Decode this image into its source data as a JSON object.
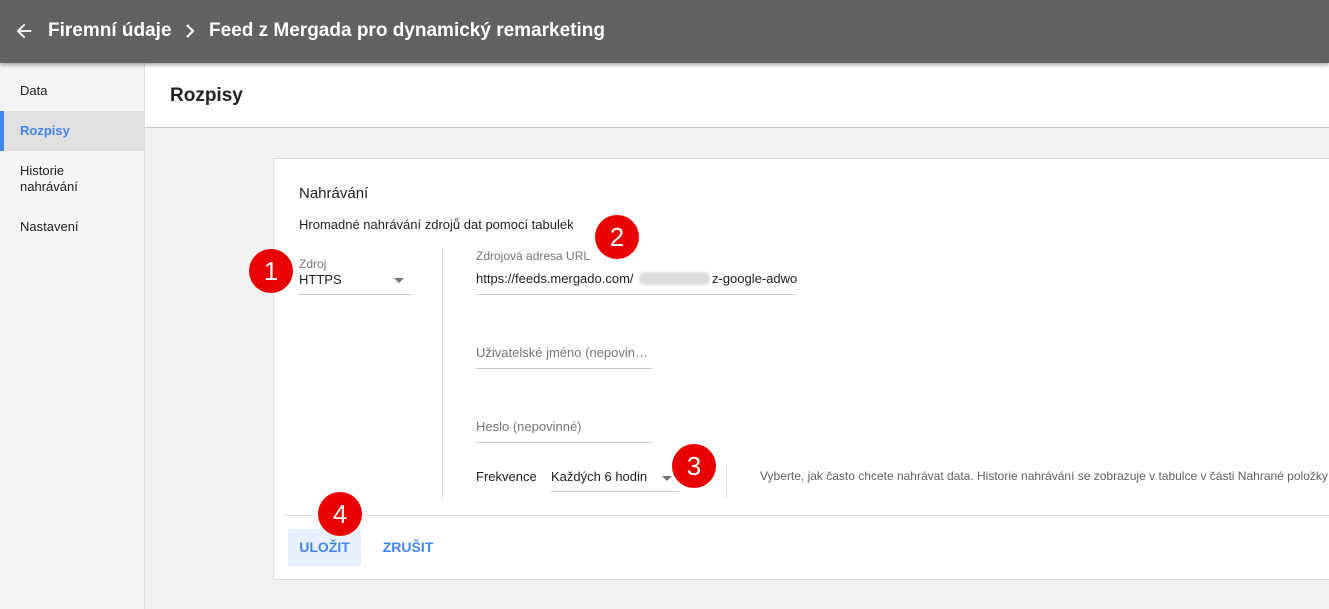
{
  "header": {
    "back_icon": "arrow-left-icon",
    "breadcrumb_parent": "Firemní údaje",
    "separator_icon": "chevron-right-icon",
    "breadcrumb_current": "Feed z Mergada pro dynamický remarketing"
  },
  "sidebar": {
    "items": [
      {
        "label": "Data",
        "active": false
      },
      {
        "label": "Rozpisy",
        "active": true
      },
      {
        "label": "Historie nahrávání",
        "active": false
      },
      {
        "label": "Nastavení",
        "active": false
      }
    ]
  },
  "page": {
    "title": "Rozpisy"
  },
  "upload": {
    "section_title": "Nahrávání",
    "subtitle": "Hromadné nahrávání zdrojů dat pomocí tabulek",
    "source": {
      "label": "Zdroj",
      "value": "HTTPS"
    },
    "url": {
      "label": "Zdrojová adresa URL",
      "value_prefix": "https://feeds.mergado.com/",
      "value_suffix": "z-google-adwo"
    },
    "username": {
      "placeholder": "Uživatelské jméno (nepovinné)"
    },
    "password": {
      "placeholder": "Heslo (nepovinné)"
    },
    "frequency": {
      "label": "Frekvence",
      "value": "Každých 6 hodin",
      "help": "Vyberte, jak často chcete nahrávat data. Historie nahrávání se zobrazuje v tabulce v části Nahrané položky"
    },
    "actions": {
      "save": "ULOŽIT",
      "cancel": "ZRUŠIT"
    }
  },
  "annotations": {
    "colors": {
      "badge": "#e80000"
    },
    "badges": [
      "1",
      "2",
      "3",
      "4"
    ]
  },
  "colors": {
    "topbar": "#616161",
    "accent": "#4285f4",
    "save_bg": "#e8f0fe"
  }
}
